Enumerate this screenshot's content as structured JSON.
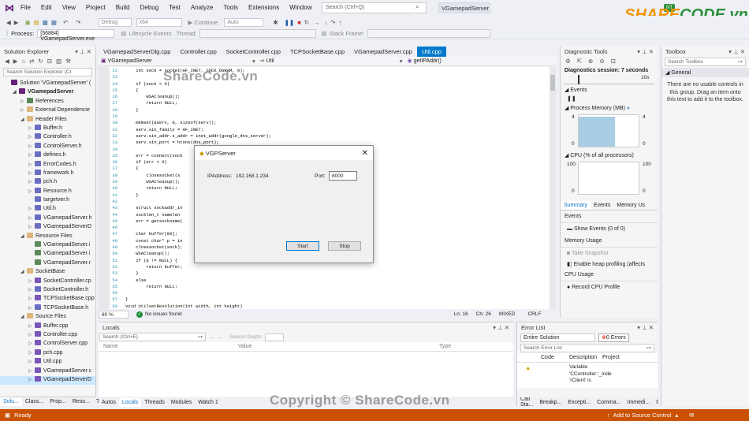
{
  "menubar": {
    "items": [
      "File",
      "Edit",
      "View",
      "Project",
      "Build",
      "Debug",
      "Test",
      "Analyze",
      "Tools",
      "Extensions",
      "Window",
      "Help"
    ],
    "search_placeholder": "Search (Ctrl+Q)",
    "solution_badge": "VGamepadServer",
    "live_share": "NT"
  },
  "toolbar": {
    "config": "Debug",
    "platform": "x64",
    "continue": "Continue",
    "auto": "Auto"
  },
  "procbar": {
    "process_label": "Process:",
    "process_value": "[56884] VGamepadServer.exe",
    "lifecycle": "Lifecycle Events",
    "thread": "Thread:",
    "stack_frame": "Stack Frame:"
  },
  "solution_explorer": {
    "title": "Solution Explorer",
    "search_placeholder": "Search Solution Explorer (Ct",
    "items": [
      {
        "label": "Solution 'VGamepadServer' (",
        "indent": 0,
        "tw": "",
        "icon": "ic-p"
      },
      {
        "label": "VGamepadServer",
        "indent": 1,
        "tw": "◢",
        "icon": "ic-p",
        "bold": true
      },
      {
        "label": "References",
        "indent": 2,
        "tw": "▷",
        "icon": "ic-r"
      },
      {
        "label": "External Dependencie",
        "indent": 2,
        "tw": "▷",
        "icon": "ic-f"
      },
      {
        "label": "Header Files",
        "indent": 2,
        "tw": "◢",
        "icon": "ic-f"
      },
      {
        "label": "Buffer.h",
        "indent": 3,
        "tw": "▷",
        "icon": "ic-h"
      },
      {
        "label": "Controller.h",
        "indent": 3,
        "tw": "▷",
        "icon": "ic-h"
      },
      {
        "label": "ControlServer.h",
        "indent": 3,
        "tw": "▷",
        "icon": "ic-h"
      },
      {
        "label": "defines.h",
        "indent": 3,
        "tw": "▷",
        "icon": "ic-h"
      },
      {
        "label": "ErrorCodes.h",
        "indent": 3,
        "tw": "▷",
        "icon": "ic-h"
      },
      {
        "label": "framework.h",
        "indent": 3,
        "tw": "▷",
        "icon": "ic-h"
      },
      {
        "label": "pch.h",
        "indent": 3,
        "tw": "▷",
        "icon": "ic-h"
      },
      {
        "label": "Resource.h",
        "indent": 3,
        "tw": "▷",
        "icon": "ic-h"
      },
      {
        "label": "targetver.h",
        "indent": 3,
        "tw": "",
        "icon": "ic-h"
      },
      {
        "label": "Util.h",
        "indent": 3,
        "tw": "▷",
        "icon": "ic-h"
      },
      {
        "label": "VGamepadServer.h",
        "indent": 3,
        "tw": "▷",
        "icon": "ic-h"
      },
      {
        "label": "VGamepadServerD",
        "indent": 3,
        "tw": "▷",
        "icon": "ic-h"
      },
      {
        "label": "Resource Files",
        "indent": 2,
        "tw": "◢",
        "icon": "ic-f"
      },
      {
        "label": "VGamepadServer.i",
        "indent": 3,
        "tw": "",
        "icon": "ic-r"
      },
      {
        "label": "VGamepadServer.i",
        "indent": 3,
        "tw": "",
        "icon": "ic-r"
      },
      {
        "label": "VGamepadServer.r",
        "indent": 3,
        "tw": "",
        "icon": "ic-r"
      },
      {
        "label": "SocketBase",
        "indent": 2,
        "tw": "◢",
        "icon": "ic-f"
      },
      {
        "label": "SocketController.cp",
        "indent": 3,
        "tw": "▷",
        "icon": "ic-c"
      },
      {
        "label": "SocketController.h",
        "indent": 3,
        "tw": "▷",
        "icon": "ic-h"
      },
      {
        "label": "TCPSocketBase.cpp",
        "indent": 3,
        "tw": "▷",
        "icon": "ic-c"
      },
      {
        "label": "TCPSocketBase.h",
        "indent": 3,
        "tw": "▷",
        "icon": "ic-h"
      },
      {
        "label": "Source Files",
        "indent": 2,
        "tw": "◢",
        "icon": "ic-f"
      },
      {
        "label": "Buffer.cpp",
        "indent": 3,
        "tw": "▷",
        "icon": "ic-c"
      },
      {
        "label": "Controller.cpp",
        "indent": 3,
        "tw": "▷",
        "icon": "ic-c"
      },
      {
        "label": "ControlServer.cpp",
        "indent": 3,
        "tw": "▷",
        "icon": "ic-c"
      },
      {
        "label": "pch.cpp",
        "indent": 3,
        "tw": "▷",
        "icon": "ic-c"
      },
      {
        "label": "Util.cpp",
        "indent": 3,
        "tw": "▷",
        "icon": "ic-c"
      },
      {
        "label": "VGamepadServer.c",
        "indent": 3,
        "tw": "▷",
        "icon": "ic-c"
      },
      {
        "label": "VGamepadServerD",
        "indent": 3,
        "tw": "▷",
        "icon": "ic-c",
        "selected": true
      }
    ],
    "bottom_tabs": [
      "Solu...",
      "Class...",
      "Prop...",
      "Reso...",
      "Team..."
    ]
  },
  "editor": {
    "tabs": [
      "VGamepadServerDlg.cpp",
      "Controller.cpp",
      "SocketController.cpp",
      "TCPSocketBase.cpp",
      "VGamepadServer.cpp",
      "Util.cpp"
    ],
    "active_tab": "Util.cpp",
    "nav_project": "VGamepadServer",
    "nav_scope": "Util",
    "nav_member": "getIPAddr()",
    "code_lines": [
      {
        "n": "22",
        "t": "    int sock = socket(AF_INET, SOCK_DGRAM, 0);"
      },
      {
        "n": "23",
        "t": ""
      },
      {
        "n": "24",
        "t": "    if (sock < 0)"
      },
      {
        "n": "25",
        "t": "    {"
      },
      {
        "n": "26",
        "t": "        WSACleanup();"
      },
      {
        "n": "27",
        "t": "        return NULL;"
      },
      {
        "n": "28",
        "t": "    }"
      },
      {
        "n": "29",
        "t": ""
      },
      {
        "n": "30",
        "t": "    memset(&serv, 0, sizeof(serv));"
      },
      {
        "n": "31",
        "t": "    serv.sin_family = AF_INET;"
      },
      {
        "n": "32",
        "t": "    serv.sin_addr.s_addr = inet_addr(google_dns_server);"
      },
      {
        "n": "33",
        "t": "    serv.sin_port = htons(dns_port);"
      },
      {
        "n": "34",
        "t": ""
      },
      {
        "n": "35",
        "t": "    err = connect(sock"
      },
      {
        "n": "36",
        "t": "    if (err < 0)"
      },
      {
        "n": "37",
        "t": "    {"
      },
      {
        "n": "38",
        "t": "        closesocket(s"
      },
      {
        "n": "39",
        "t": "        WSACleanup();"
      },
      {
        "n": "40",
        "t": "        return NULL;"
      },
      {
        "n": "41",
        "t": "    }"
      },
      {
        "n": "42",
        "t": ""
      },
      {
        "n": "43",
        "t": "    struct sockaddr_in"
      },
      {
        "n": "44",
        "t": "    socklen_t namelen"
      },
      {
        "n": "45",
        "t": "    err = getsockname("
      },
      {
        "n": "46",
        "t": ""
      },
      {
        "n": "47",
        "t": "    char buffer[80];"
      },
      {
        "n": "48",
        "t": "    const char* p = in"
      },
      {
        "n": "49",
        "t": "    closesocket(sock);"
      },
      {
        "n": "50",
        "t": "    WSACleanup();"
      },
      {
        "n": "51",
        "t": "    if (p != NULL) {"
      },
      {
        "n": "52",
        "t": "        return buffer;"
      },
      {
        "n": "53",
        "t": "    }"
      },
      {
        "n": "54",
        "t": "    else"
      },
      {
        "n": "55",
        "t": "        return NULL;"
      },
      {
        "n": "56",
        "t": ""
      },
      {
        "n": "57",
        "t": "}"
      },
      {
        "n": "58",
        "t": "void UtilsetResolution(int width, int height)"
      }
    ],
    "zoom": "80 %",
    "issues": "No issues found",
    "ln": "Ln: 16",
    "ch": "Ch: 26",
    "mixed": "MIXED",
    "crlf": "CRLF"
  },
  "dialog": {
    "title": "VGPServer",
    "ip_label": "IPAddress:",
    "ip_value": "192.168.1.234",
    "port_label": "Port:",
    "port_value": "8000",
    "start": "Start",
    "stop": "Stop"
  },
  "diagnostic": {
    "title": "Diagnostic Tools",
    "session": "Diagnostics session: 7 seconds",
    "timeline_mark": "10s",
    "events": "Events",
    "memory_title": "Process Memory (MB)",
    "mem_max": "4",
    "mem_min": "0",
    "cpu_title": "CPU (% of all processors)",
    "cpu_max": "100",
    "cpu_min": "0",
    "tabs": [
      "Summary",
      "Events",
      "Memory Us"
    ],
    "sec_events": "Events",
    "show_events": "Show Events (0 of 0)",
    "sec_memory": "Memory Usage",
    "take_snapshot": "Take Snapshot",
    "enable_heap": "Enable heap profiling (affects",
    "sec_cpu": "CPU Usage",
    "record_cpu": "Record CPU Profile"
  },
  "toolbox": {
    "title": "Toolbox",
    "search_placeholder": "Search Toolbox",
    "group": "General",
    "empty_text": "There are no usable controls in this group. Drag an item onto this text to add it to the toolbox."
  },
  "locals": {
    "title": "Locals",
    "search_placeholder": "Search (Ctrl+E)",
    "depth_label": "Search Depth:",
    "col_name": "Name",
    "col_value": "Value",
    "col_type": "Type",
    "bottom_tabs": [
      "Autos",
      "Locals",
      "Threads",
      "Modules",
      "Watch 1"
    ]
  },
  "errors": {
    "title": "Error List",
    "scope": "Entire Solution",
    "count": "0 Errors",
    "search_placeholder": "Search Error List",
    "col_code": "Code",
    "col_desc": "Description",
    "col_project": "Project",
    "row_desc": "Variable 'CController::_inde 'rClient' is",
    "bottom_tabs": [
      "Call Sta...",
      "Breakp...",
      "Excepti...",
      "Comma...",
      "Immedi...",
      "Output",
      "Error List"
    ]
  },
  "statusbar": {
    "ready": "Ready",
    "add_source": "Add to Source Control"
  },
  "watermarks": {
    "top": "ShareCode.vn",
    "bottom": "Copyright © ShareCode.vn",
    "brand_share": "SHARE",
    "brand_code": "CODE.vn"
  }
}
